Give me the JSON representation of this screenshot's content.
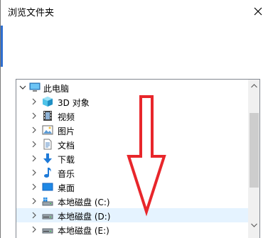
{
  "window": {
    "title": "浏览文件夹"
  },
  "tree": {
    "items": [
      {
        "label": "此电脑",
        "icon": "computer-icon",
        "expanded": true,
        "level": 0
      },
      {
        "label": "3D 对象",
        "icon": "3d-objects-icon",
        "level": 1
      },
      {
        "label": "视频",
        "icon": "videos-icon",
        "level": 1
      },
      {
        "label": "图片",
        "icon": "pictures-icon",
        "level": 1
      },
      {
        "label": "文档",
        "icon": "documents-icon",
        "level": 1
      },
      {
        "label": "下载",
        "icon": "downloads-icon",
        "level": 1
      },
      {
        "label": "音乐",
        "icon": "music-icon",
        "level": 1
      },
      {
        "label": "桌面",
        "icon": "desktop-icon",
        "level": 1
      },
      {
        "label": "本地磁盘 (C:)",
        "icon": "windows-drive-icon",
        "level": 1
      },
      {
        "label": "本地磁盘 (D:)",
        "icon": "drive-icon",
        "level": 1,
        "selected": true
      },
      {
        "label": "本地磁盘 (E:)",
        "icon": "drive-icon",
        "level": 1
      }
    ]
  },
  "colors": {
    "annotation_arrow": "#e8262b",
    "selection": "#e5f3ff",
    "accent": "#2f6fd0"
  }
}
